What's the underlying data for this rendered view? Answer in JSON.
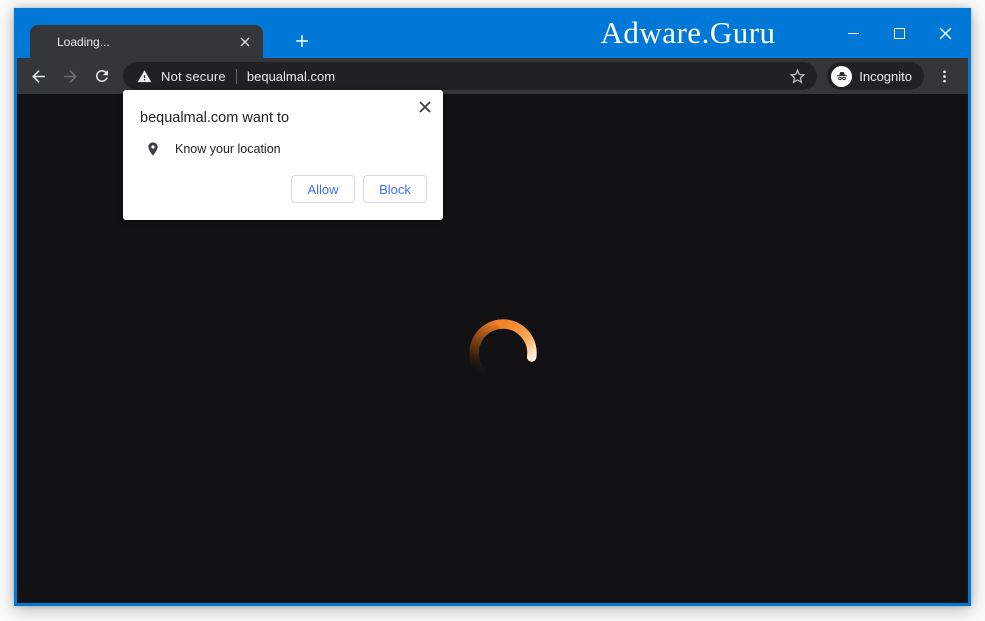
{
  "titlebar": {
    "app_title": "Adware.Guru"
  },
  "tab_strip": {
    "active_tab": {
      "title": "Loading...",
      "close_icon": "tab-close-icon"
    },
    "new_tab_icon": "plus-icon"
  },
  "toolbar": {
    "back_icon": "arrow-left-icon",
    "forward_icon": "arrow-right-icon",
    "reload_icon": "reload-icon",
    "security_icon": "warning-triangle-icon",
    "security_label": "Not secure",
    "url": "bequalmal.com",
    "bookmark_icon": "star-icon",
    "incognito": {
      "icon": "incognito-icon",
      "label": "Incognito"
    },
    "menu_icon": "kebab-menu-icon"
  },
  "permission_dialog": {
    "title": "bequalmal.com want to",
    "close_icon": "close-x-icon",
    "request": {
      "icon": "location-pin-icon",
      "label": "Know your location"
    },
    "buttons": {
      "allow": "Allow",
      "block": "Block"
    }
  },
  "page": {
    "spinner_icon": "loading-spinner"
  },
  "colors": {
    "titlebar_blue": "#0078d7",
    "chrome_dark": "#35363a",
    "omnibox_dark": "#202124",
    "page_bg": "#121214",
    "text_light": "#e8eaed",
    "spinner_orange": "#f08228",
    "spinner_head": "#ffeed8",
    "dialog_button_blue": "#4070e8",
    "dialog_text": "#202124"
  }
}
